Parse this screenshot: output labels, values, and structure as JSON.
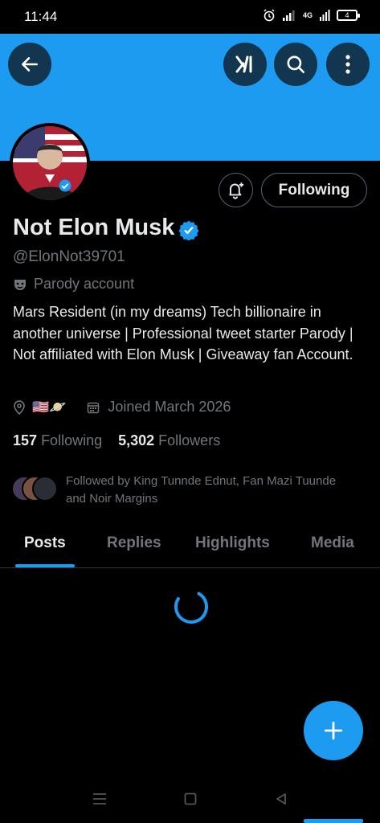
{
  "status_bar": {
    "time": "11:44",
    "battery": "4",
    "network": "4G"
  },
  "header": {
    "back_icon": "arrow-left-icon",
    "grok_icon": "grok-icon",
    "search_icon": "search-icon",
    "more_icon": "more-vertical-icon",
    "banner_color": "#1d9bf0"
  },
  "profile": {
    "display_name": "Not Elon Musk",
    "handle": "@ElonNot39701",
    "parody_label": "Parody account",
    "bio": "Mars Resident (in my dreams) Tech billionaire in another universe | Professional tweet starter Parody | Not affiliated with Elon Musk | Giveaway fan Account.",
    "location_emoji": "🇺🇸🪐",
    "joined": "Joined March 2026",
    "following_count": "157",
    "following_label": "Following",
    "followers_count": "5,302",
    "followers_label": "Followers",
    "followed_by": "Followed by King Tunnde Ednut, Fan Mazi Tuunde and Noir Margins"
  },
  "actions": {
    "notify_icon": "bell-plus-icon",
    "following_button": "Following"
  },
  "tabs": [
    {
      "label": "Posts",
      "active": true
    },
    {
      "label": "Replies",
      "active": false
    },
    {
      "label": "Highlights",
      "active": false
    },
    {
      "label": "Media",
      "active": false
    }
  ],
  "fab": {
    "icon": "plus-icon"
  },
  "nav": {
    "menu_icon": "recent-apps-icon",
    "home_icon": "home-square-icon",
    "back_icon": "back-triangle-icon"
  },
  "colors": {
    "accent": "#1d9bf0",
    "text_primary": "#e7e9ea",
    "text_secondary": "#71767b",
    "background": "#000000"
  }
}
